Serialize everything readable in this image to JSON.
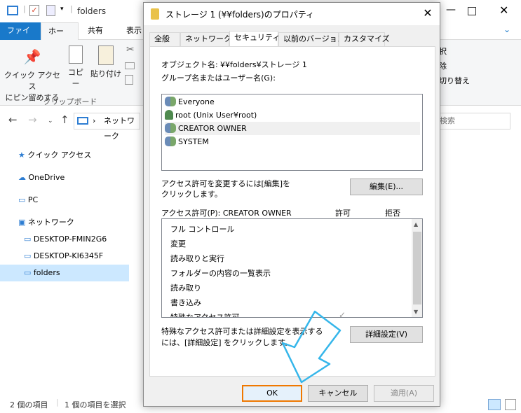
{
  "explorer": {
    "title": "folders",
    "ribbon_tabs": [
      "ファイル",
      "ホーム",
      "共有",
      "表示"
    ],
    "clipboard": {
      "pin_label_1": "クイック アクセス",
      "pin_label_2": "にピン留めする",
      "copy": "コピー",
      "paste": "貼り付け",
      "group": "クリップボード"
    },
    "ribbon_right": [
      "択",
      "除",
      "切り替え"
    ],
    "address": "ネットワーク",
    "search_placeholder": "検索",
    "nav": {
      "quick": "クイック アクセス",
      "onedrive": "OneDrive",
      "pc": "PC",
      "network": "ネットワーク",
      "desk1": "DESKTOP-FMIN2G6",
      "desk2": "DESKTOP-KI6345F",
      "folders": "folders"
    },
    "status_items": "2 個の項目",
    "status_selected": "1 個の項目を選択"
  },
  "dialog": {
    "title": "ストレージ 1 (¥¥folders)のプロパティ",
    "tabs": [
      "全般",
      "ネットワーク",
      "セキュリティ",
      "以前のバージョン",
      "カスタマイズ"
    ],
    "object_label": "オブジェクト名:",
    "object_value": "¥¥folders¥ストレージ 1",
    "group_label": "グループ名またはユーザー名(G):",
    "groups": [
      "Everyone",
      "root (Unix User¥root)",
      "CREATOR OWNER",
      "SYSTEM"
    ],
    "change_text_1": "アクセス許可を変更するには[編集]を",
    "change_text_2": "クリックします。",
    "edit_button": "編集(E)...",
    "perm_label": "アクセス許可(P): CREATOR OWNER",
    "allow_header": "許可",
    "deny_header": "拒否",
    "permissions": [
      "フル コントロール",
      "変更",
      "読み取りと実行",
      "フォルダーの内容の一覧表示",
      "読み取り",
      "書き込み",
      "特殊なアクセス許可"
    ],
    "advanced_text_1": "特殊なアクセス許可または詳細設定を表示する",
    "advanced_text_2": "には、[詳細設定] をクリックします。",
    "advanced_button": "詳細設定(V)",
    "ok": "OK",
    "cancel": "キャンセル",
    "apply": "適用(A)",
    "colors": {
      "ok_highlight": "#f07800",
      "arrow": "#35b6ea"
    }
  }
}
